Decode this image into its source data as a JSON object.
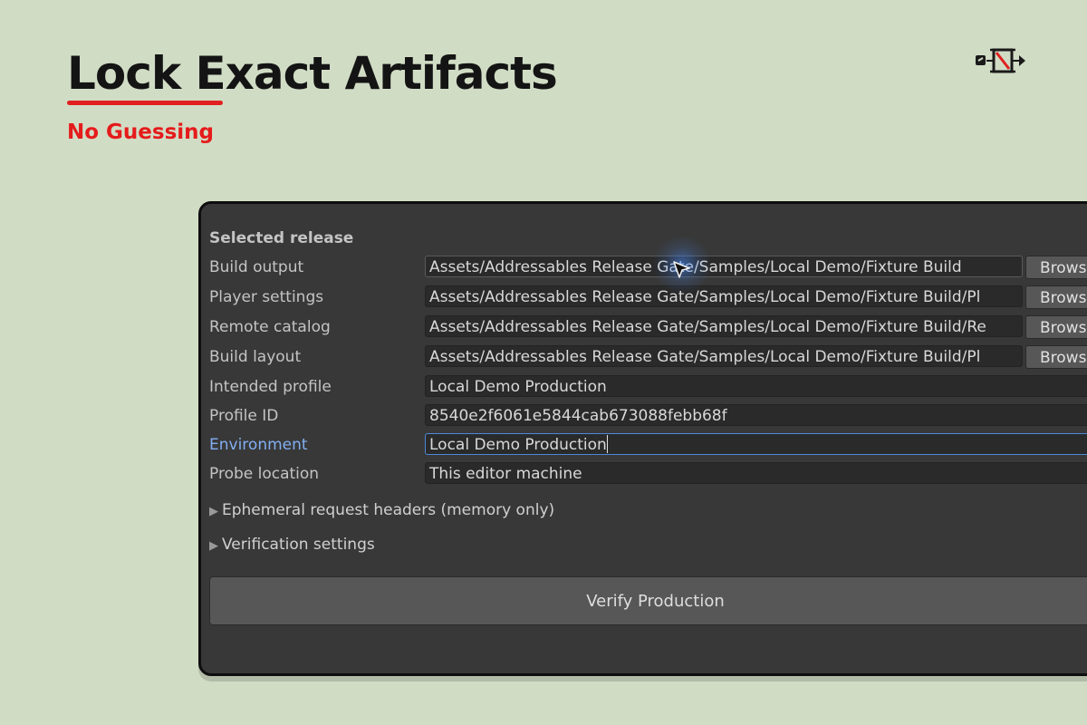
{
  "headline": {
    "title": "Lock Exact Artifacts",
    "subtitle": "No Guessing"
  },
  "colors": {
    "background": "#d1dcc5",
    "accent_red": "#e51b1b",
    "panel": "#383838",
    "focus_blue": "#4d88d6"
  },
  "panel": {
    "section_title": "Selected release",
    "rows": [
      {
        "label": "Build output",
        "value": "Assets/Addressables Release Gate/Samples/Local Demo/Fixture Build",
        "button": "Browse"
      },
      {
        "label": "Player settings",
        "value": "Assets/Addressables Release Gate/Samples/Local Demo/Fixture Build/Pl",
        "button": "Browse"
      },
      {
        "label": "Remote catalog",
        "value": "Assets/Addressables Release Gate/Samples/Local Demo/Fixture Build/Re",
        "button": "Browse"
      },
      {
        "label": "Build layout",
        "value": "Assets/Addressables Release Gate/Samples/Local Demo/Fixture Build/Pl",
        "button": "Browse"
      },
      {
        "label": "Intended profile",
        "value": "Local Demo Production"
      },
      {
        "label": "Profile ID",
        "value": "8540e2f6061e5844cab673088febb68f"
      },
      {
        "label": "Environment",
        "value": "Local Demo Production"
      },
      {
        "label": "Probe location",
        "value": "This editor machine"
      }
    ],
    "foldouts": [
      "Ephemeral request headers (memory only)",
      "Verification settings"
    ],
    "verify_button": "Verify Production"
  },
  "icons": {
    "logo": "build-pipeline-icon",
    "cursor": "mouse-pointer-icon",
    "foldout": "triangle-right-icon"
  }
}
